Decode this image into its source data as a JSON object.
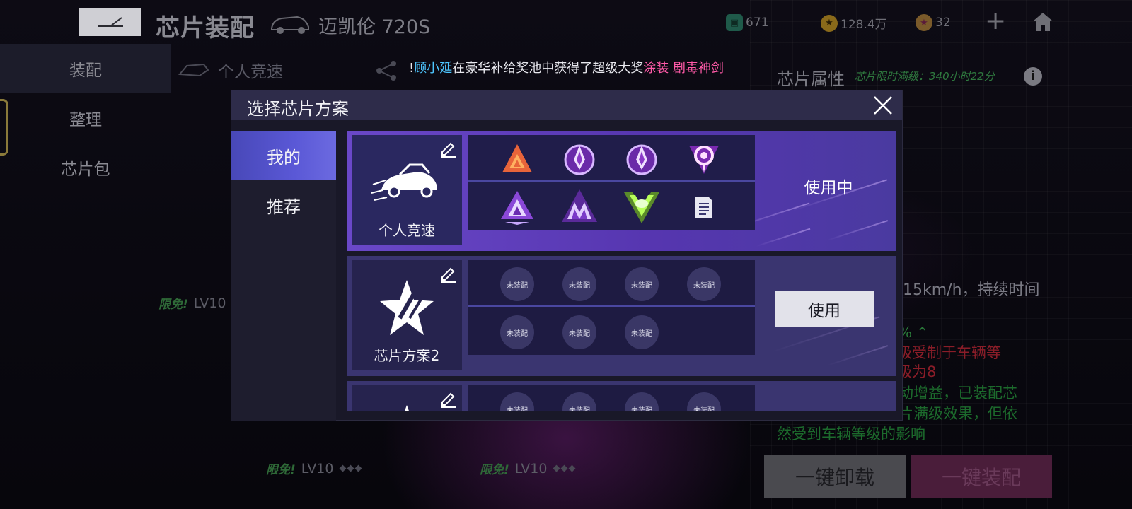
{
  "topbar": {
    "page_title": "芯片装配",
    "car_name": "迈凯伦 720S",
    "resources": [
      {
        "icon": "ticket-icon",
        "value": "671"
      },
      {
        "icon": "coin-icon",
        "value": "128.4万"
      },
      {
        "icon": "star-coin-icon",
        "value": "32"
      }
    ]
  },
  "left_nav": [
    "装配",
    "整理",
    "芯片包"
  ],
  "sub_tab": "个人竞速",
  "ticker": {
    "prefix": "!",
    "player": "顾小延",
    "middle": "在豪华补给奖池中获得了超级大奖",
    "prize": "涂装 剧毒神剑"
  },
  "attr_panel": {
    "title": "芯片属性",
    "subtitle": "芯片限时满级：340小时22分",
    "desc_speed": "15km/h，持续时间",
    "desc_percent": "% ⌃",
    "desc_red_1": "级受制于车辆等",
    "desc_red_2": "级为8",
    "desc_green_1": "动增益，已装配芯",
    "desc_green_2": "片满级效果，但依",
    "desc_green_3": "然受到车辆等级的影响",
    "unload_label": "一键卸载",
    "equip_label": "一键装配"
  },
  "bg_levels": [
    {
      "free": "限免!",
      "lv": "LV10 ("
    },
    {
      "free": "限免!",
      "lv": "LV10"
    },
    {
      "free": "限免!",
      "lv": "LV10"
    }
  ],
  "modal": {
    "title": "选择芯片方案",
    "tabs": [
      "我的",
      "推荐"
    ],
    "active_tab": "我的",
    "schemes": [
      {
        "name": "个人竞速",
        "status": "使用中",
        "chips": [
          "flame-triangle-chip",
          "purple-diamond-chip",
          "purple-diamond-chip",
          "target-shield-chip",
          "purple-triangle-chip",
          "purple-mountain-chip",
          "green-wing-chip",
          "document-icon"
        ]
      },
      {
        "name": "芯片方案2",
        "action": "使用",
        "empty_label": "未装配",
        "empty_slots": 7
      },
      {
        "empty_label": "未装配"
      }
    ]
  },
  "colors": {
    "accent_purple": "#6a48c8",
    "ticker_name": "#4ec6ff",
    "ticker_prize": "#ff5aa8"
  }
}
